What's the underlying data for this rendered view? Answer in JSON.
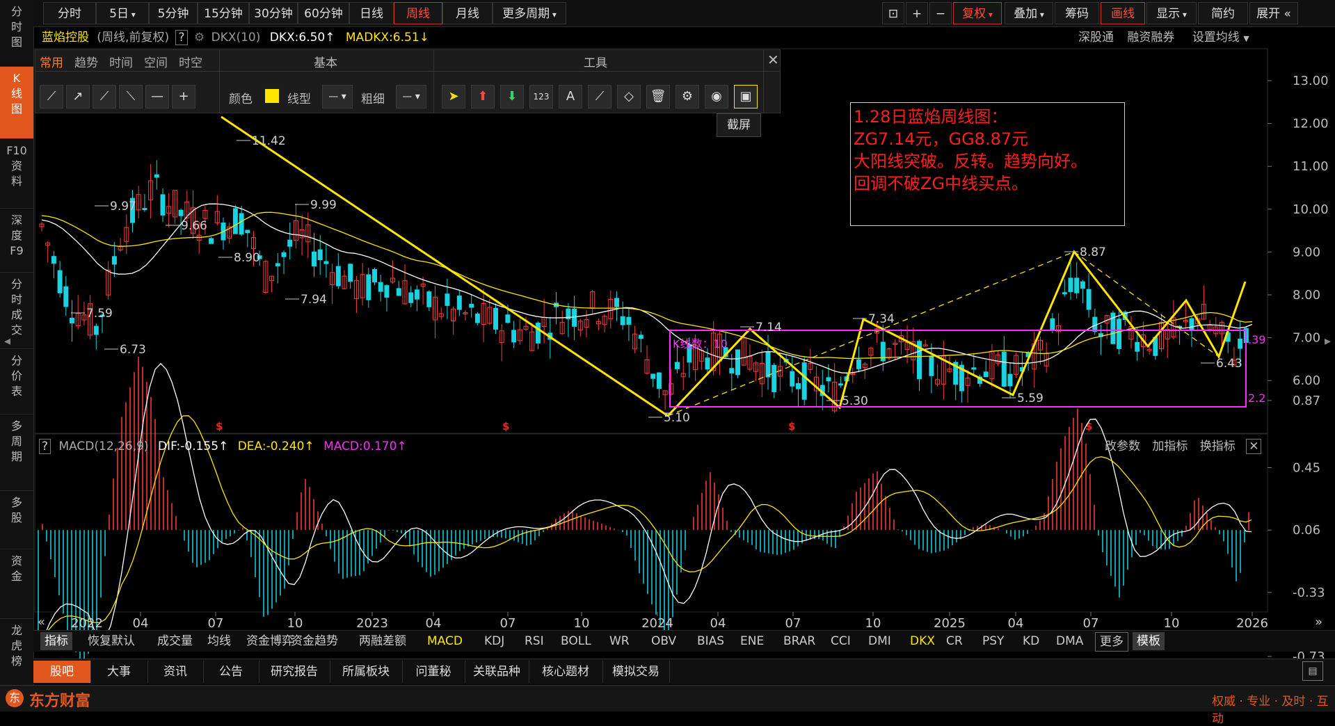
{
  "sidebar": [
    {
      "label": "分\n时\n图",
      "active": false
    },
    {
      "label": "K\n线\n图",
      "active": true
    },
    {
      "label": "F10\n资\n料",
      "active": false
    },
    {
      "label": "深\n度\nF9",
      "active": false
    },
    {
      "label": "分\n时\n成\n交",
      "active": false
    },
    {
      "label": "分\n价\n表",
      "active": false
    },
    {
      "label": "多\n周\n期",
      "active": false
    },
    {
      "label": "多\n股",
      "active": false
    },
    {
      "label": "资\n金",
      "active": false
    },
    {
      "label": "龙\n虎\n榜",
      "active": false
    }
  ],
  "topbar": {
    "periods": [
      "分时",
      "5日",
      "5分钟",
      "15分钟",
      "30分钟",
      "60分钟",
      "日线",
      "周线",
      "月线",
      "更多周期"
    ],
    "active_period": "周线",
    "right": [
      "复权",
      "叠加",
      "筹码",
      "画线",
      "显示",
      "简约",
      "展开"
    ]
  },
  "stock": {
    "name": "蓝焰控股",
    "mode": "(周线,前复权)",
    "help": "?",
    "indicator": "DKX(10)",
    "dkx": "DKX:6.50↑",
    "madkx": "MADKX:6.51↓",
    "links": [
      "深股通",
      "融资融券",
      "设置均线"
    ]
  },
  "drawpanel": {
    "tabs": [
      "常用",
      "趋势",
      "时间",
      "空间",
      "时空"
    ],
    "section_basic": "基本",
    "section_tools": "工具",
    "color_label": "颜色",
    "line_label": "线型",
    "width_label": "粗细",
    "tooltip": "截屏"
  },
  "note": {
    "lines": [
      "1.28日蓝焰周线图：",
      "ZG7.14元，GG8.87元",
      "大阳线突破。反转。趋势向好。",
      "回调不破ZG中线买点。"
    ]
  },
  "price_axis": [
    "13.00",
    "12.00",
    "11.00",
    "10.00",
    "9.00",
    "8.00",
    "7.00",
    "6.00"
  ],
  "price_labels": [
    "11.42",
    "9.97",
    "9.99",
    "9.66",
    "8.90",
    "7.94",
    "7.59",
    "6.73",
    "7.14",
    "7.34",
    "8.87",
    "5.10",
    "5.30",
    "5.59",
    "6.43"
  ],
  "box_label": "K线数：10",
  "box_right_top": ".39",
  "box_right_bottom": "2.2",
  "macd": {
    "name": "MACD(12,26,9)",
    "dif": "DIF:-0.155↑",
    "dea": "DEA:-0.240↑",
    "macd": "MACD:0.170↑",
    "actions": [
      "改参数",
      "加指标",
      "换指标"
    ],
    "axis": [
      "0.87",
      "0.45",
      "0.06",
      "-0.33",
      "-0.73"
    ]
  },
  "x_axis": [
    "2022",
    "04",
    "07",
    "10",
    "2023",
    "04",
    "07",
    "10",
    "2024",
    "04",
    "07",
    "10",
    "2025",
    "04",
    "07",
    "10",
    "2026"
  ],
  "indicators": [
    "指标",
    "恢复默认",
    "成交量",
    "均线",
    "资金博弈",
    "资金趋势",
    "两融差额",
    "MACD",
    "KDJ",
    "RSI",
    "BOLL",
    "WR",
    "OBV",
    "BIAS",
    "ENE",
    "BRAR",
    "CCI",
    "DMI",
    "DKX",
    "CR",
    "PSY",
    "KD",
    "DMA",
    "更多",
    "模板"
  ],
  "bottom_tabs": [
    "股吧",
    "大事",
    "资讯",
    "公告",
    "研究报告",
    "所属板块",
    "问董秘",
    "关联品种",
    "核心题材",
    "模拟交易"
  ],
  "footer": {
    "brand": "东方财富",
    "slogan": "权威 · 专业 · 及时 · 互动"
  },
  "colors": {
    "up": "#ff3b3b",
    "down": "#19d3e0",
    "yellow": "#ffe600",
    "magenta": "#ff2bff",
    "accent": "#e2571d"
  }
}
